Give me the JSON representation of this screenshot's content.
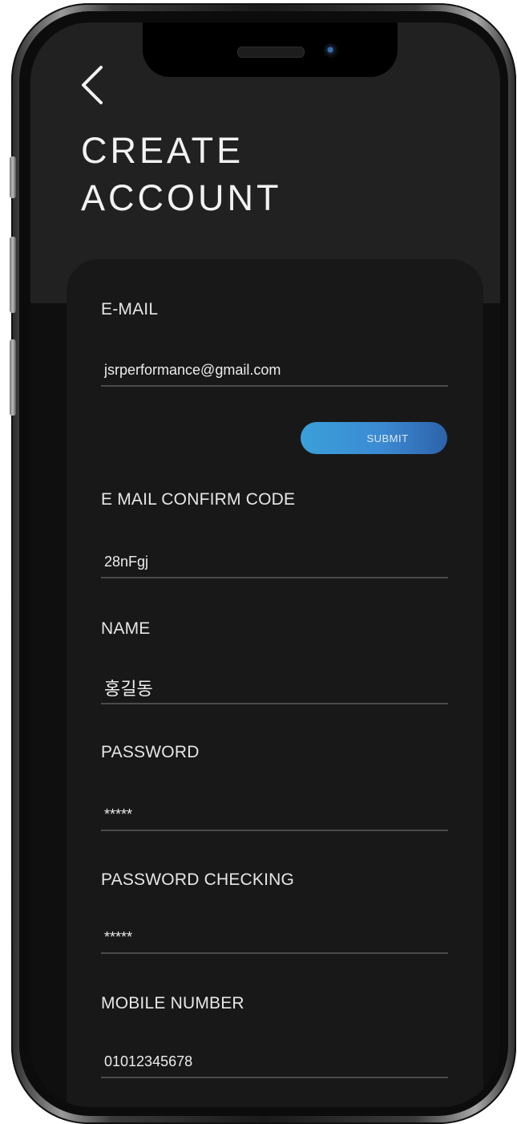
{
  "header": {
    "title_line1": "CREATE",
    "title_line2": "ACCOUNT"
  },
  "icons": {
    "back": "chevron-left-icon",
    "camera": "front-camera-icon",
    "speaker": "earpiece-speaker-icon"
  },
  "colors": {
    "background": "#0f0f0f",
    "header": "#212121",
    "card": "#181818",
    "accent": "#3a9ad8",
    "text": "#e6e6e6",
    "divider": "#4a4a4a"
  },
  "form": {
    "email": {
      "label": "E-MAIL",
      "value": "jsrperformance@gmail.com"
    },
    "submit_label": "SUBMIT",
    "confirm_code": {
      "label": "E MAIL CONFIRM CODE",
      "value": "28nFgj"
    },
    "name": {
      "label": "NAME",
      "value": "홍길동"
    },
    "password": {
      "label": "PASSWORD",
      "value": "*****"
    },
    "password_check": {
      "label": "PASSWORD CHECKING",
      "value": "*****"
    },
    "mobile": {
      "label": "MOBILE NUMBER",
      "value": "01012345678"
    }
  }
}
